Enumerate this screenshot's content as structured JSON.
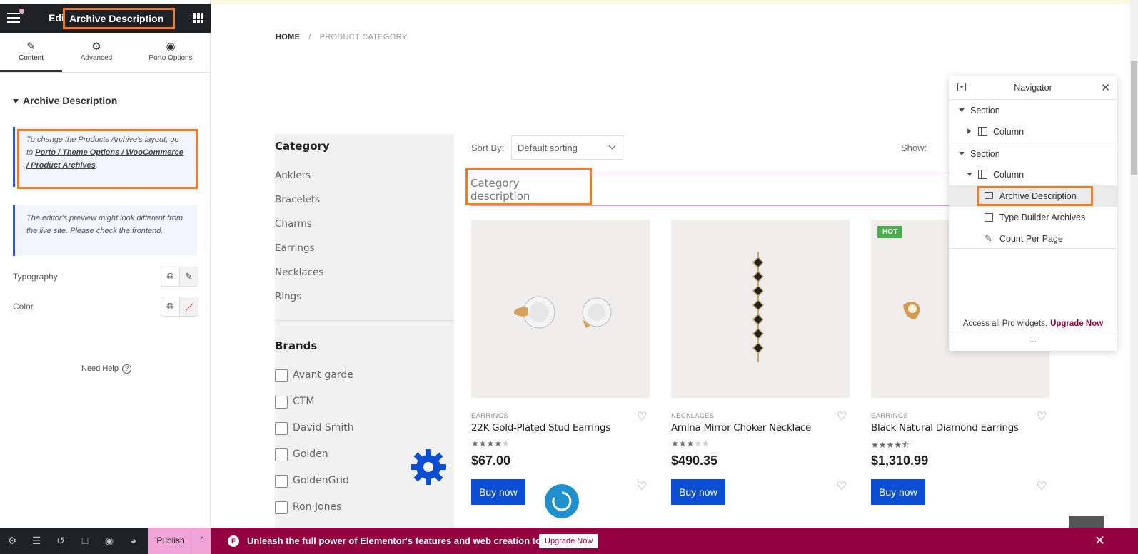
{
  "panel": {
    "title_prefix": "Edit",
    "title": "Archive Description",
    "tabs": [
      {
        "label": "Content",
        "icon": "pencil-icon"
      },
      {
        "label": "Advanced",
        "icon": "gear-icon"
      },
      {
        "label": "Porto Options",
        "icon": "circle-icon"
      }
    ],
    "section_title": "Archive Description",
    "notice1": {
      "text": "To change the Products Archive's layout, go to ",
      "link": "Porto / Theme Options / WooCommerce / Product Archives",
      "suffix": "."
    },
    "notice2": "The editor's preview might look different from the live site. Please check the frontend.",
    "controls": [
      {
        "label": "Typography"
      },
      {
        "label": "Color"
      }
    ],
    "need_help": "Need Help"
  },
  "bottom_bar": {
    "publish_label": "Publish"
  },
  "promo": {
    "text": "Unleash the full power of Elementor's features and web creation tools.",
    "button": "Upgrade Now"
  },
  "preview": {
    "breadcrumb": {
      "home": "HOME",
      "current": "PRODUCT CATEGORY"
    },
    "sidebar": {
      "category_heading": "Category",
      "categories": [
        "Anklets",
        "Bracelets",
        "Charms",
        "Earrings",
        "Necklaces",
        "Rings"
      ],
      "brands_heading": "Brands",
      "brands": [
        "Avant garde",
        "CTM",
        "David Smith",
        "Golden",
        "GoldenGrid",
        "Ron Jones"
      ]
    },
    "toolbar": {
      "sort_label": "Sort By:",
      "sort_value": "Default sorting",
      "show_label": "Show:"
    },
    "category_description": "Category description",
    "products": [
      {
        "category": "EARRINGS",
        "name": "22K Gold-Plated Stud Earrings",
        "rating": 4,
        "price": "$67.00",
        "buy": "Buy now",
        "badge": ""
      },
      {
        "category": "NECKLACES",
        "name": "Amina Mirror Choker Necklace",
        "rating": 3,
        "price": "$490.35",
        "buy": "Buy now",
        "badge": ""
      },
      {
        "category": "EARRINGS",
        "name": "Black Natural Diamond Earrings",
        "rating": 4.5,
        "price": "$1,310.99",
        "buy": "Buy now",
        "badge": "HOT"
      }
    ]
  },
  "navigator": {
    "title": "Navigator",
    "items": [
      {
        "label": "Section",
        "level": 0
      },
      {
        "label": "Column",
        "level": 1
      },
      {
        "label": "Section",
        "level": 0
      },
      {
        "label": "Column",
        "level": 1
      },
      {
        "label": "Archive Description",
        "level": 2
      },
      {
        "label": "Type Builder Archives",
        "level": 2
      },
      {
        "label": "Count Per Page",
        "level": 2
      }
    ],
    "footer_text": "Access all Pro widgets.",
    "footer_link": "Upgrade Now",
    "more": "..."
  },
  "colors": {
    "accent_pink": "#f0a3d6",
    "promo_bg": "#93003f",
    "highlight_orange": "#f47b20",
    "buy_blue": "#0b4dd3"
  }
}
